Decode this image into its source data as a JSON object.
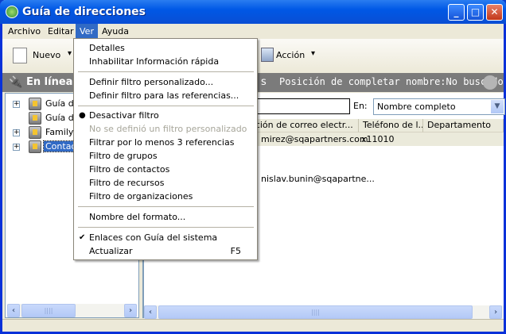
{
  "window": {
    "title": "Guía de direcciones",
    "minimize": "_",
    "maximize": "□",
    "close": "✕"
  },
  "menubar": [
    "Archivo",
    "Editar",
    "Ver",
    "Ayuda"
  ],
  "toolbar": {
    "new_label": "Nuevo",
    "action_label": "Acción",
    "dropdown": "▾"
  },
  "band": {
    "title": "En línea",
    "partial": "s",
    "status": "Posición de completar nombre:No buscado"
  },
  "search": {
    "in_label": "En:",
    "field_value": "",
    "select_value": "Nombre completo"
  },
  "tree": [
    {
      "label": "Guía de",
      "expand": "+"
    },
    {
      "label": "Guía de",
      "expand": ""
    },
    {
      "label": "Family",
      "expand": "+"
    },
    {
      "label": "Contacto",
      "expand": "+",
      "selected": true
    }
  ],
  "columns": [
    "ección de correo electr...",
    "Teléfono de l...",
    "Departamento"
  ],
  "rows": [
    {
      "email": "mirez@sqapartners.com",
      "phone": "x11010"
    },
    {
      "email": "nislav.bunin@sqapartne...",
      "phone": ""
    }
  ],
  "menu": {
    "items": [
      {
        "label": "Detalles"
      },
      {
        "label": "Inhabilitar Información rápida"
      },
      {
        "label": "Definir filtro personalizado..."
      },
      {
        "label": "Definir filtro para las referencias..."
      },
      {
        "label": "Desactivar filtro",
        "mark": "●"
      },
      {
        "label": "No se definió un filtro personalizado",
        "disabled": true
      },
      {
        "label": "Filtrar por lo menos 3 referencias"
      },
      {
        "label": "Filtro de grupos"
      },
      {
        "label": "Filtro de contactos"
      },
      {
        "label": "Filtro de recursos"
      },
      {
        "label": "Filtro de organizaciones"
      },
      {
        "label": "Nombre del formato..."
      },
      {
        "label": "Enlaces con Guía del sistema",
        "mark": "✔"
      },
      {
        "label": "Actualizar",
        "shortcut": "F5"
      }
    ]
  },
  "scroll": {
    "left": "‹",
    "right": "›",
    "grip": "||||"
  }
}
